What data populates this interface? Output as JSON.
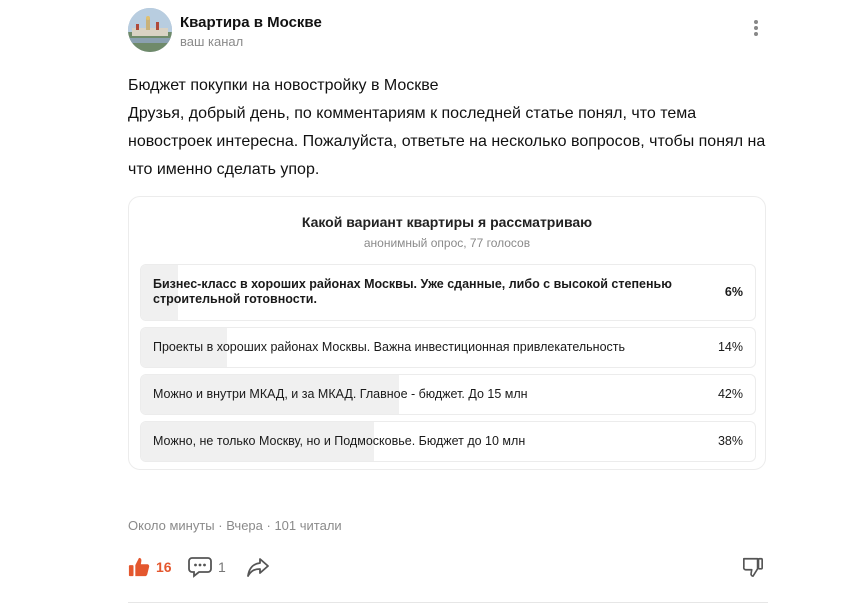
{
  "channel": {
    "name": "Квартира в Москве",
    "subtitle": "ваш канал",
    "avatar_icon": "kremlin-photo-avatar"
  },
  "post": {
    "title": "Бюджет покупки на новостройку в Москве",
    "body": "Друзья, добрый день, по комментариям к последней статье понял, что тема новостроек интересна. Пожалуйста, ответьте на несколько вопросов, чтобы понял на что именно сделать упор."
  },
  "poll": {
    "title": "Какой вариант квартиры я рассматриваю",
    "subtitle": "анонимный опрос, 77 голосов",
    "options": [
      {
        "label": "Бизнес-класс в хороших районах Москвы. Уже сданные, либо с высокой степенью строительной готовности.",
        "percent": "6%",
        "fraction": 0.06,
        "chosen": true
      },
      {
        "label": "Проекты в хороших районах Москвы. Важна инвестиционная привлекательность",
        "percent": "14%",
        "fraction": 0.14,
        "chosen": false
      },
      {
        "label": "Можно и внутри МКАД, и за МКАД. Главное - бюджет. До 15 млн",
        "percent": "42%",
        "fraction": 0.42,
        "chosen": false
      },
      {
        "label": "Можно, не только Москву, но и Подмосковье. Бюджет до 10 млн",
        "percent": "38%",
        "fraction": 0.38,
        "chosen": false
      }
    ]
  },
  "meta": "Около минуты · Вчера · 101 читали",
  "actions": {
    "likes": "16",
    "comments": "1",
    "like_color": "#e4572e"
  }
}
